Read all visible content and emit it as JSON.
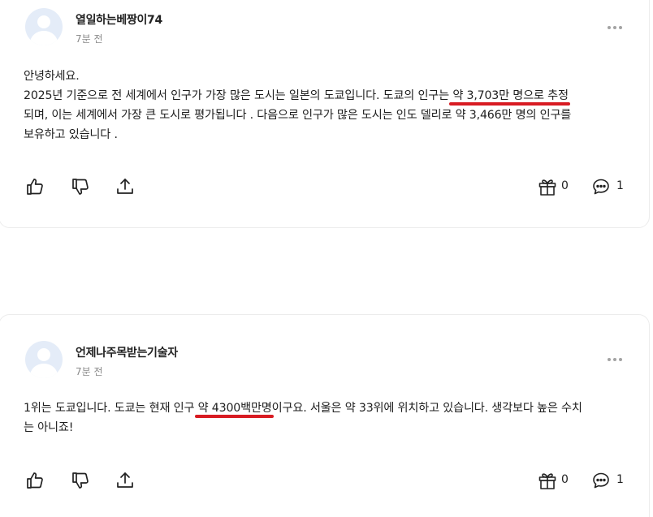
{
  "posts": [
    {
      "author": "열일하는베짱이74",
      "time": "7분 전",
      "greeting": "안녕하세요.",
      "line1_pre": "2025년 기준으로 전 세계에서 인구가 가장 많은 도시는 일본의 도쿄입니다. 도쿄의 인구는 ",
      "line1_hl": "약 3,703만 명으로 추정",
      "line2": "되며, 이는 세계에서 가장 큰 도시로 평가됩니다 . 다음으로 인구가 많은 도시는 인도 델리로 약 3,466만 명의 인구를",
      "line3": "보유하고 있습니다 .",
      "gift_count": "0",
      "comment_count": "1"
    },
    {
      "author": "언제나주목받는기술자",
      "time": "7분 전",
      "line1_pre": "1위는 도쿄입니다. 도쿄는 현재 인구 ",
      "line1_hl": "약 4300백만명",
      "line1_post": "이구요. 서울은 약 33위에 위치하고 있습니다. 생각보다 높은 수치",
      "line2": "는 아니죠!",
      "gift_count": "0",
      "comment_count": "1"
    }
  ],
  "icons": [
    "thumbs-up-icon",
    "thumbs-down-icon",
    "share-icon",
    "gift-icon",
    "comment-icon",
    "more-icon"
  ],
  "colors": {
    "highlight_underline": "#d81b22",
    "avatar_bg": "#e4ecf8",
    "muted_text": "#8a8a8a"
  }
}
